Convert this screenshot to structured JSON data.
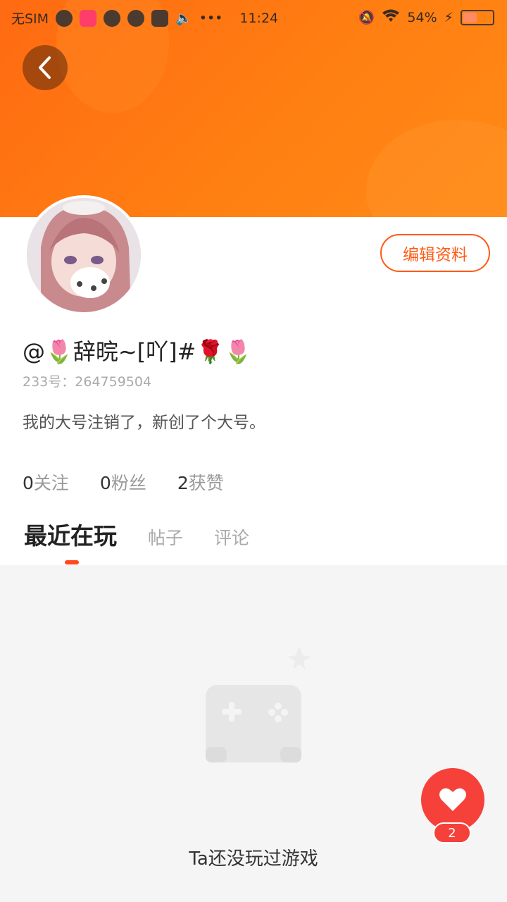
{
  "status_bar": {
    "carrier": "无SIM",
    "time": "11:24",
    "dots": "•••",
    "battery": "54%",
    "battery_level": 0.54
  },
  "profile": {
    "username": "@🌷辞晥~[吖]#🌹🌷",
    "uid": "233号：264759504",
    "bio": "我的大号注销了，新创了个大号。",
    "edit_button": "编辑资料"
  },
  "stats": [
    {
      "num": "0",
      "label": "关注"
    },
    {
      "num": "0",
      "label": "粉丝"
    },
    {
      "num": "2",
      "label": "获赞"
    }
  ],
  "tabs": [
    "最近在玩",
    "帖子",
    "评论"
  ],
  "empty_state": {
    "title": "Ta还没玩过游戏"
  },
  "like_fab": {
    "count": "2"
  },
  "colors": {
    "accent": "#ff5a14",
    "fab": "#f5413a"
  }
}
